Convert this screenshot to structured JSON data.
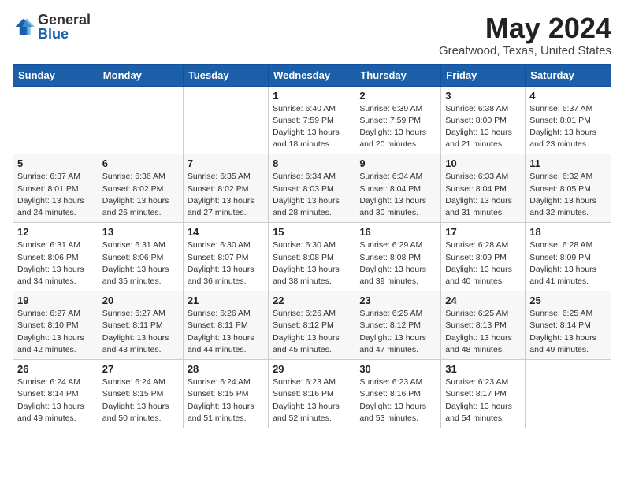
{
  "logo": {
    "general": "General",
    "blue": "Blue"
  },
  "title": "May 2024",
  "location": "Greatwood, Texas, United States",
  "days_of_week": [
    "Sunday",
    "Monday",
    "Tuesday",
    "Wednesday",
    "Thursday",
    "Friday",
    "Saturday"
  ],
  "weeks": [
    [
      {
        "day": "",
        "info": ""
      },
      {
        "day": "",
        "info": ""
      },
      {
        "day": "",
        "info": ""
      },
      {
        "day": "1",
        "info": "Sunrise: 6:40 AM\nSunset: 7:59 PM\nDaylight: 13 hours\nand 18 minutes."
      },
      {
        "day": "2",
        "info": "Sunrise: 6:39 AM\nSunset: 7:59 PM\nDaylight: 13 hours\nand 20 minutes."
      },
      {
        "day": "3",
        "info": "Sunrise: 6:38 AM\nSunset: 8:00 PM\nDaylight: 13 hours\nand 21 minutes."
      },
      {
        "day": "4",
        "info": "Sunrise: 6:37 AM\nSunset: 8:01 PM\nDaylight: 13 hours\nand 23 minutes."
      }
    ],
    [
      {
        "day": "5",
        "info": "Sunrise: 6:37 AM\nSunset: 8:01 PM\nDaylight: 13 hours\nand 24 minutes."
      },
      {
        "day": "6",
        "info": "Sunrise: 6:36 AM\nSunset: 8:02 PM\nDaylight: 13 hours\nand 26 minutes."
      },
      {
        "day": "7",
        "info": "Sunrise: 6:35 AM\nSunset: 8:02 PM\nDaylight: 13 hours\nand 27 minutes."
      },
      {
        "day": "8",
        "info": "Sunrise: 6:34 AM\nSunset: 8:03 PM\nDaylight: 13 hours\nand 28 minutes."
      },
      {
        "day": "9",
        "info": "Sunrise: 6:34 AM\nSunset: 8:04 PM\nDaylight: 13 hours\nand 30 minutes."
      },
      {
        "day": "10",
        "info": "Sunrise: 6:33 AM\nSunset: 8:04 PM\nDaylight: 13 hours\nand 31 minutes."
      },
      {
        "day": "11",
        "info": "Sunrise: 6:32 AM\nSunset: 8:05 PM\nDaylight: 13 hours\nand 32 minutes."
      }
    ],
    [
      {
        "day": "12",
        "info": "Sunrise: 6:31 AM\nSunset: 8:06 PM\nDaylight: 13 hours\nand 34 minutes."
      },
      {
        "day": "13",
        "info": "Sunrise: 6:31 AM\nSunset: 8:06 PM\nDaylight: 13 hours\nand 35 minutes."
      },
      {
        "day": "14",
        "info": "Sunrise: 6:30 AM\nSunset: 8:07 PM\nDaylight: 13 hours\nand 36 minutes."
      },
      {
        "day": "15",
        "info": "Sunrise: 6:30 AM\nSunset: 8:08 PM\nDaylight: 13 hours\nand 38 minutes."
      },
      {
        "day": "16",
        "info": "Sunrise: 6:29 AM\nSunset: 8:08 PM\nDaylight: 13 hours\nand 39 minutes."
      },
      {
        "day": "17",
        "info": "Sunrise: 6:28 AM\nSunset: 8:09 PM\nDaylight: 13 hours\nand 40 minutes."
      },
      {
        "day": "18",
        "info": "Sunrise: 6:28 AM\nSunset: 8:09 PM\nDaylight: 13 hours\nand 41 minutes."
      }
    ],
    [
      {
        "day": "19",
        "info": "Sunrise: 6:27 AM\nSunset: 8:10 PM\nDaylight: 13 hours\nand 42 minutes."
      },
      {
        "day": "20",
        "info": "Sunrise: 6:27 AM\nSunset: 8:11 PM\nDaylight: 13 hours\nand 43 minutes."
      },
      {
        "day": "21",
        "info": "Sunrise: 6:26 AM\nSunset: 8:11 PM\nDaylight: 13 hours\nand 44 minutes."
      },
      {
        "day": "22",
        "info": "Sunrise: 6:26 AM\nSunset: 8:12 PM\nDaylight: 13 hours\nand 45 minutes."
      },
      {
        "day": "23",
        "info": "Sunrise: 6:25 AM\nSunset: 8:12 PM\nDaylight: 13 hours\nand 47 minutes."
      },
      {
        "day": "24",
        "info": "Sunrise: 6:25 AM\nSunset: 8:13 PM\nDaylight: 13 hours\nand 48 minutes."
      },
      {
        "day": "25",
        "info": "Sunrise: 6:25 AM\nSunset: 8:14 PM\nDaylight: 13 hours\nand 49 minutes."
      }
    ],
    [
      {
        "day": "26",
        "info": "Sunrise: 6:24 AM\nSunset: 8:14 PM\nDaylight: 13 hours\nand 49 minutes."
      },
      {
        "day": "27",
        "info": "Sunrise: 6:24 AM\nSunset: 8:15 PM\nDaylight: 13 hours\nand 50 minutes."
      },
      {
        "day": "28",
        "info": "Sunrise: 6:24 AM\nSunset: 8:15 PM\nDaylight: 13 hours\nand 51 minutes."
      },
      {
        "day": "29",
        "info": "Sunrise: 6:23 AM\nSunset: 8:16 PM\nDaylight: 13 hours\nand 52 minutes."
      },
      {
        "day": "30",
        "info": "Sunrise: 6:23 AM\nSunset: 8:16 PM\nDaylight: 13 hours\nand 53 minutes."
      },
      {
        "day": "31",
        "info": "Sunrise: 6:23 AM\nSunset: 8:17 PM\nDaylight: 13 hours\nand 54 minutes."
      },
      {
        "day": "",
        "info": ""
      }
    ]
  ]
}
